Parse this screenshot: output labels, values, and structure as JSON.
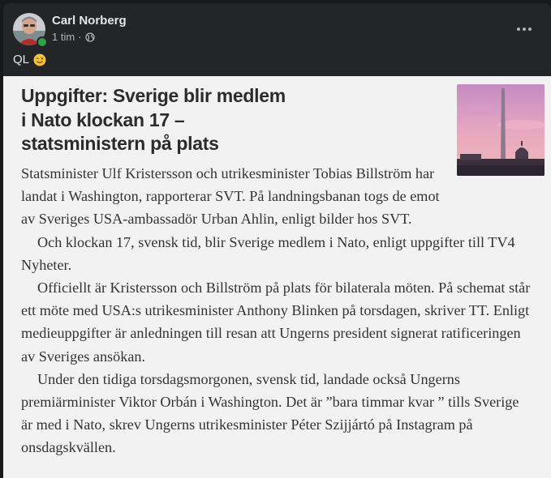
{
  "post": {
    "author": "Carl Norberg",
    "time": "1 tim",
    "separator": "·",
    "privacy_icon": "globe-icon",
    "text": "QL",
    "emoji": "winking-face-emoji",
    "online": true
  },
  "article": {
    "headline_lines": [
      "Uppgifter: Sverige blir medlem",
      "i Nato klockan 17 –",
      "statsministern på plats"
    ],
    "paragraphs": [
      "Statsminister Ulf Kristersson och utrikesminister Tobias Billström har landat i Washington, rapporterar SVT. På landningsbanan togs de emot av Sveriges USA-ambassadör Urban Ahlin, enligt bilder hos SVT.",
      "Och klockan 17, svensk tid, blir Sverige medlem i Nato, enligt uppgifter till TV4 Nyheter.",
      "Officiellt är Kristersson och Billström på plats för bilaterala möten. På schemat står ett möte med USA:s utrikesminister Anthony Blinken på torsdagen, skriver TT. Enligt medieuppgifter är anledningen till resan att Ungerns president signerat ratificeringen av Sveriges ansökan.",
      "Under den tidiga torsdagsmorgonen, svensk tid, landade också Ungerns premiärminister Viktor Orbán i Washington. Det är ”bara timmar kvar ” tills Sverige är med i Nato, skrev Ungerns utrikesminister Péter Szijjártó på Instagram på onsdagskvällen."
    ],
    "thumbnail": "washington-monument-sunset-photo"
  },
  "colors": {
    "card_bg": "#242526",
    "page_bg": "#18191a",
    "text_primary": "#e4e6eb",
    "text_secondary": "#b0b3b8",
    "online_green": "#31a24c",
    "article_bg": "#f2f2f2"
  }
}
